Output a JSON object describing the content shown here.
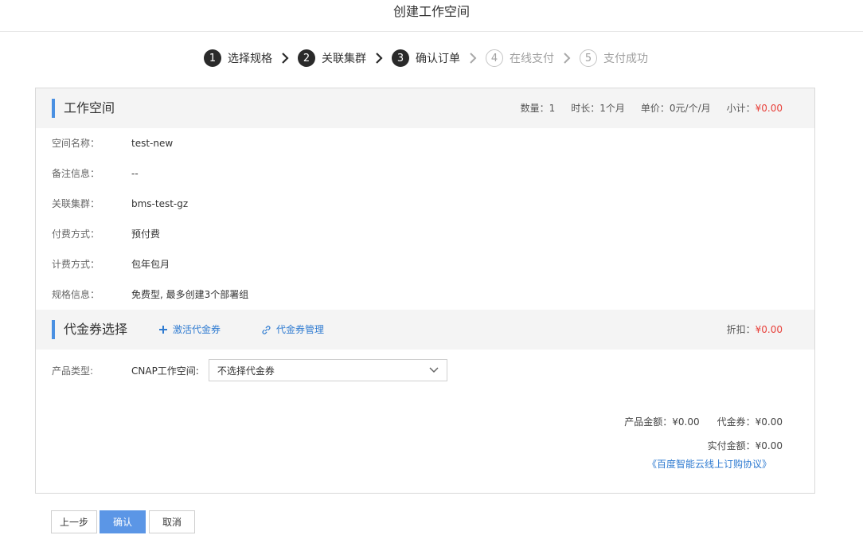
{
  "page": {
    "title": "创建工作空间"
  },
  "steps": [
    {
      "num": "1",
      "label": "选择规格",
      "state": "done"
    },
    {
      "num": "2",
      "label": "关联集群",
      "state": "done"
    },
    {
      "num": "3",
      "label": "确认订单",
      "state": "done"
    },
    {
      "num": "4",
      "label": "在线支付",
      "state": "todo"
    },
    {
      "num": "5",
      "label": "支付成功",
      "state": "todo"
    }
  ],
  "workspace": {
    "title": "工作空间",
    "summary": {
      "quantity": "数量：1",
      "duration": "时长：1个月",
      "unit_price": "单价：0元/个/月",
      "subtotal_label": "小计：",
      "subtotal_value": "¥0.00"
    },
    "fields": [
      {
        "label": "空间名称：",
        "value": "test-new"
      },
      {
        "label": "备注信息：",
        "value": "--"
      },
      {
        "label": "关联集群：",
        "value": "bms-test-gz"
      },
      {
        "label": "付费方式：",
        "value": "预付费"
      },
      {
        "label": "计费方式：",
        "value": "包年包月"
      },
      {
        "label": "规格信息：",
        "value": "免费型, 最多创建3个部署组"
      }
    ]
  },
  "coupon": {
    "title": "代金券选择",
    "activate_label": "激活代金券",
    "manage_label": "代金券管理",
    "discount_label": "折扣：",
    "discount_value": "¥0.00",
    "product_type_label": "产品类型:",
    "product_name": "CNAP工作空间:",
    "select_value": "不选择代金券"
  },
  "totals": {
    "product_amount": "产品金额：¥0.00",
    "coupon_amount": "代金券：¥0.00",
    "paid_amount": "实付金额：¥0.00",
    "agreement": "《百度智能云线上订购协议》"
  },
  "buttons": {
    "prev": "上一步",
    "confirm": "确认",
    "cancel": "取消"
  },
  "colors": {
    "accent": "#4a90e2",
    "link": "#2f7bd1",
    "price_red": "#e8403a",
    "primary_button": "#5b96e6"
  }
}
